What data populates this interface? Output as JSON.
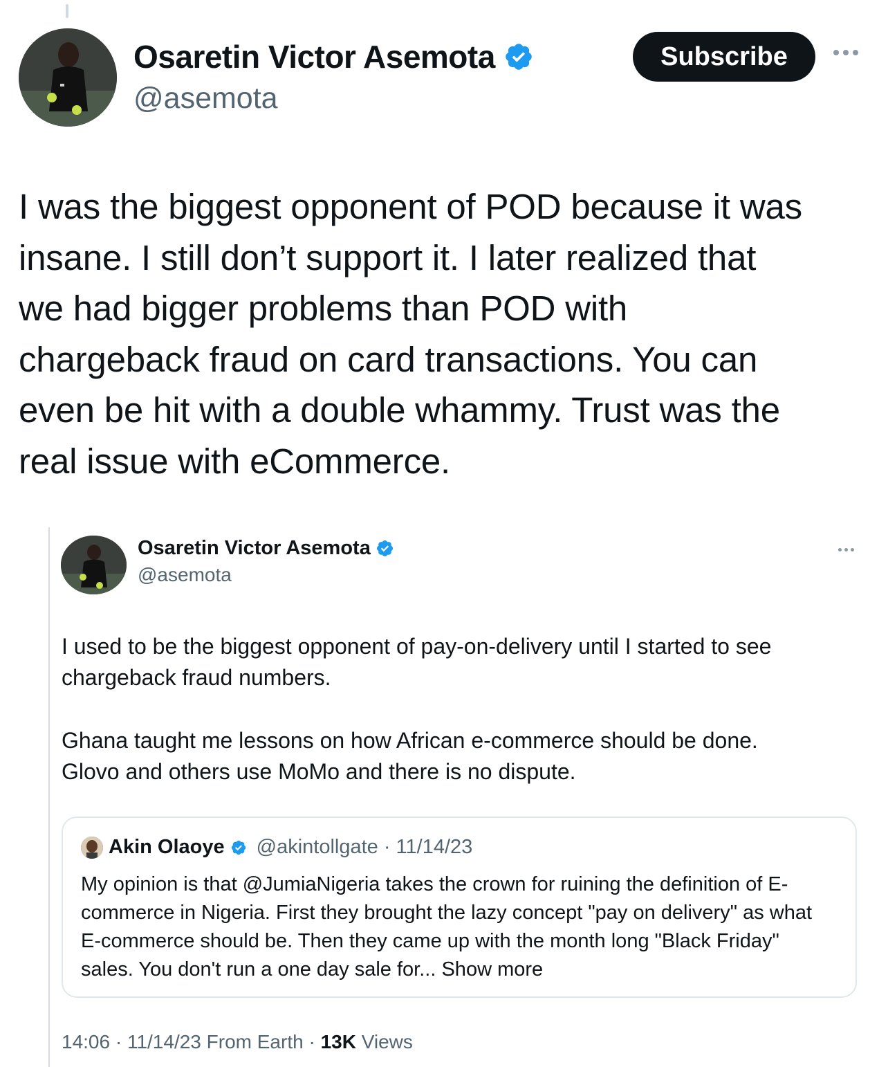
{
  "author": {
    "name": "Osaretin Victor Asemota",
    "handle": "@asemota"
  },
  "header": {
    "subscribe_label": "Subscribe"
  },
  "tweet": {
    "text": "I was the biggest opponent of POD because it was\ninsane. I still don’t support it. I later realized that\nwe had bigger problems than POD with\nchargeback fraud on card transactions. You can\neven be hit with a double whammy. Trust was the\nreal issue with eCommerce."
  },
  "quoted": {
    "name": "Osaretin Victor Asemota",
    "handle": "@asemota",
    "paragraph1": "I used to be the biggest opponent of pay-on-delivery until I started to see\nchargeback fraud numbers.",
    "paragraph2": "Ghana taught me lessons on how African e-commerce should be done.\nGlovo and others use MoMo and there is no dispute.",
    "nested": {
      "name": "Akin Olaoye",
      "handle_date": "@akintollgate · 11/14/23",
      "text": "My opinion is that @JumiaNigeria takes the crown for ruining the definition of E-\ncommerce in Nigeria. First they brought the lazy concept \"pay on delivery\" as what\nE-commerce should be. Then they came up with the month long \"Black Friday\"\nsales. You don't run a one day sale for...",
      "show_more": "Show more"
    },
    "meta": {
      "time_date_source": "14:06 · 11/14/23 From Earth · ",
      "views_count": "13K",
      "views_label": " Views"
    }
  },
  "colors": {
    "verified": "#1d9bf0",
    "text": "#0f1419",
    "secondary": "#536471",
    "button_bg": "#0f1419"
  }
}
